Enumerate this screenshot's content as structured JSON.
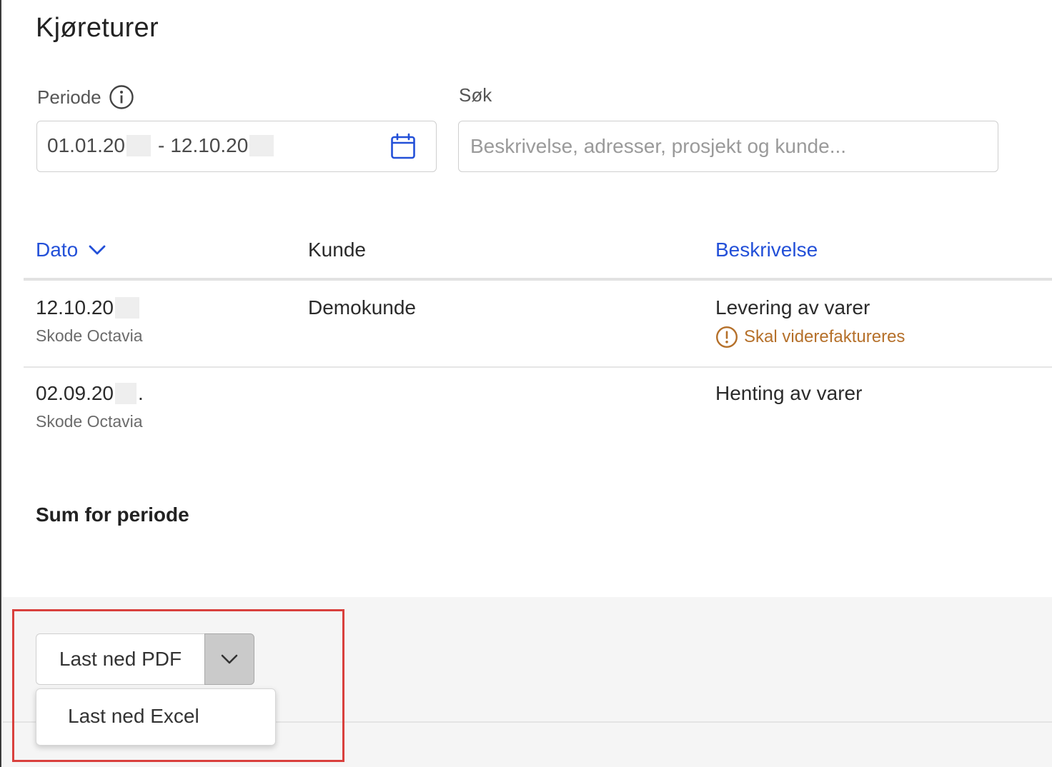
{
  "page": {
    "title": "Kjøreturer"
  },
  "filters": {
    "periode_label": "Periode",
    "periode_from": "01.01.20",
    "periode_separator": "-",
    "periode_to": "12.10.20",
    "search_label": "Søk",
    "search_placeholder": "Beskrivelse, adresser, prosjekt og kunde...",
    "search_value": ""
  },
  "table": {
    "columns": [
      {
        "label": "Dato",
        "sortable": true,
        "sorted": "desc"
      },
      {
        "label": "Kunde",
        "sortable": false
      },
      {
        "label": "Beskrivelse",
        "sortable": true
      }
    ],
    "rows": [
      {
        "date": "12.10.20",
        "vehicle": "Skode Octavia",
        "customer": "Demokunde",
        "description": "Levering av varer",
        "warning": "Skal viderefaktureres"
      },
      {
        "date": "02.09.20",
        "date_suffix": ".",
        "vehicle": "Skode Octavia",
        "customer": "",
        "description": "Henting av varer",
        "warning": ""
      }
    ]
  },
  "summary": {
    "label": "Sum for periode"
  },
  "download": {
    "primary_label": "Last ned PDF",
    "menu_items": [
      "Last ned Excel"
    ]
  },
  "colors": {
    "link_blue": "#2350d8",
    "warning": "#b5702a",
    "highlight": "#d9403d",
    "footer_bg": "#f5f5f5"
  },
  "icons": {
    "info": "info-icon",
    "calendar": "calendar-icon",
    "sort": "chevron-down-icon",
    "warning": "warning-circle-icon",
    "dropdown": "chevron-down-icon"
  }
}
